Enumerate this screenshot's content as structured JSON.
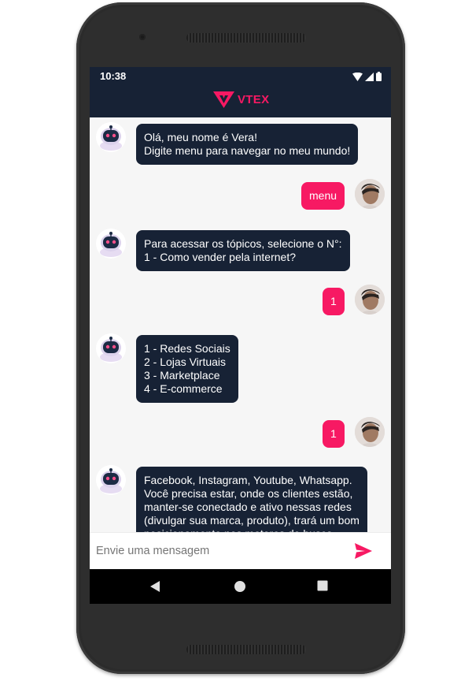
{
  "status_bar": {
    "time": "10:38"
  },
  "app_bar": {
    "brand": "VTEX"
  },
  "messages": [
    {
      "sender": "bot",
      "text": "Olá, meu nome é Vera!\nDigite menu para navegar no meu mundo!"
    },
    {
      "sender": "user",
      "text": "menu"
    },
    {
      "sender": "bot",
      "text": "Para acessar os tópicos, selecione o N°:\n1 - Como vender pela internet?"
    },
    {
      "sender": "user",
      "text": "1"
    },
    {
      "sender": "bot",
      "text": "1 - Redes Sociais\n2 - Lojas Virtuais\n3 - Marketplace\n4 - E-commerce"
    },
    {
      "sender": "user",
      "text": "1"
    },
    {
      "sender": "bot",
      "text": "Facebook, Instagram, Youtube, Whatsapp.\nVocê precisa estar, onde os clientes estão,\nmanter-se conectado e ativo nessas redes\n(divulgar sua marca, produto), trará um bom\nposicionamento nos motores de busca."
    }
  ],
  "composer": {
    "placeholder": "Envie uma mensagem"
  },
  "colors": {
    "brand": "#f71963",
    "header": "#172235",
    "bot_bubble": "#172235",
    "user_bubble": "#f71963"
  },
  "icons": {
    "send": "send-icon",
    "back": "back-triangle-icon",
    "home": "home-circle-icon",
    "recents": "recents-square-icon"
  }
}
